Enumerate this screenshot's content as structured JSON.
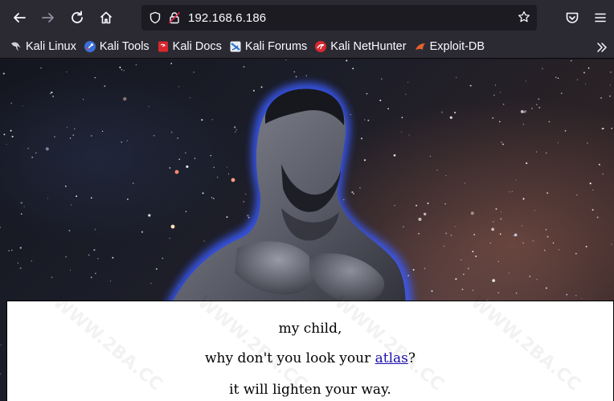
{
  "browser": {
    "url": "192.168.6.186",
    "bookmarks": [
      {
        "label": "Kali Linux",
        "icon": "kali-dragon-icon"
      },
      {
        "label": "Kali Tools",
        "icon": "kali-tools-icon"
      },
      {
        "label": "Kali Docs",
        "icon": "kali-docs-icon"
      },
      {
        "label": "Kali Forums",
        "icon": "kali-forums-icon"
      },
      {
        "label": "Kali NetHunter",
        "icon": "kali-nethunter-icon"
      },
      {
        "label": "Exploit-DB",
        "icon": "exploit-db-icon"
      }
    ]
  },
  "page": {
    "line1": "my child,",
    "line2_before": "why don't you look your ",
    "line2_link": "atlas",
    "line2_after": "?",
    "line3": "it will lighten your way.",
    "watermark": "WWW.2BA.CC"
  },
  "colors": {
    "chrome_bg": "#2b2a33",
    "urlbar_bg": "#1c1b22",
    "link": "#1a0dab",
    "figure_glow": "#3b5bff"
  }
}
